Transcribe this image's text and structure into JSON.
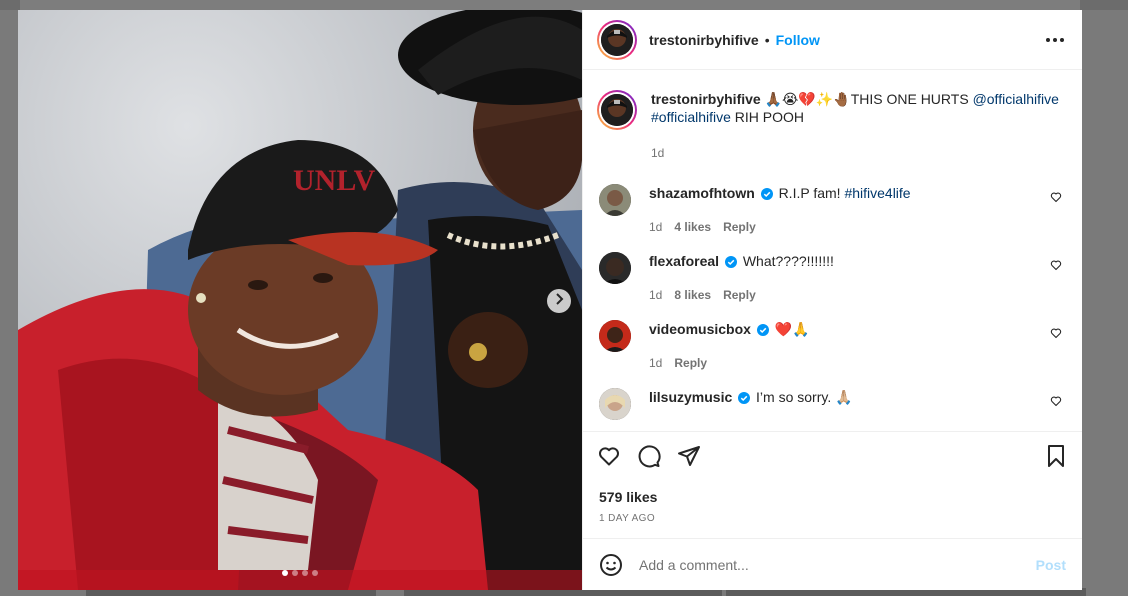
{
  "post": {
    "username": "trestonirbyhifive",
    "follow_label": "Follow",
    "separator": "•",
    "caption": {
      "username": "trestonirbyhifive",
      "emoji": "🙏🏾😭💔✨🤚🏾",
      "text": "THIS ONE HURTS",
      "mention": "@officialhifive",
      "hashtag": "#officialhifive",
      "suffix": "RIH POOH",
      "time": "1d"
    },
    "comments": [
      {
        "username": "shazamofhtown",
        "verified": true,
        "text": "R.I.P fam!",
        "hashtag": "#hifive4life",
        "time": "1d",
        "likes": "4 likes",
        "reply": "Reply"
      },
      {
        "username": "flexaforeal",
        "verified": true,
        "text": "What????!!!!!!!",
        "time": "1d",
        "likes": "8 likes",
        "reply": "Reply"
      },
      {
        "username": "videomusicbox",
        "verified": true,
        "text": "❤️🙏",
        "time": "1d",
        "reply": "Reply"
      },
      {
        "username": "lilsuzymusic",
        "verified": true,
        "text": "I’m so sorry. 🙏🏼"
      }
    ],
    "likes": "579 likes",
    "date": "1 DAY AGO",
    "add_comment_placeholder": "Add a comment...",
    "post_label": "Post",
    "carousel": {
      "total": 4,
      "active": 1
    }
  },
  "icons": {
    "more": "more-options-icon",
    "like": "heart-icon",
    "comment": "comment-icon",
    "share": "share-icon",
    "save": "bookmark-icon",
    "emoji": "emoji-icon",
    "next": "chevron-right-icon",
    "verified": "verified-badge-icon"
  },
  "colors": {
    "accent": "#0095f6",
    "verified": "#0095f6",
    "post_disabled": "#b2dffc",
    "hashtag": "#00376b"
  }
}
